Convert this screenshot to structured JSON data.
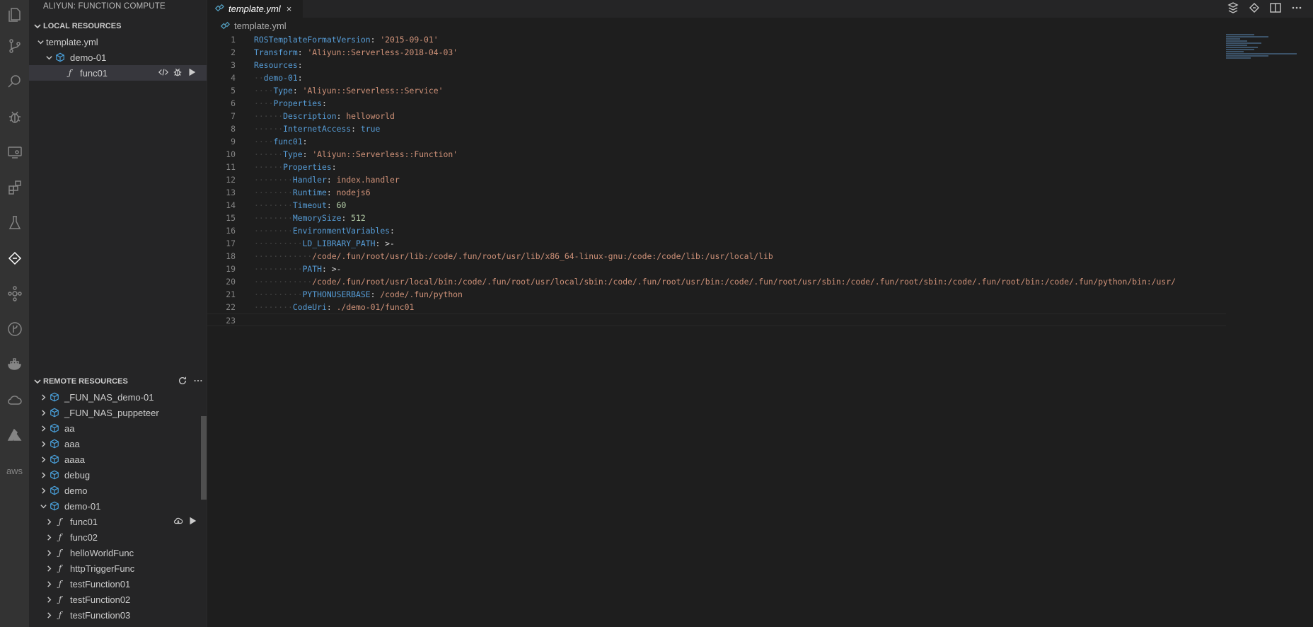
{
  "activity_bar": {
    "icons": [
      "explorer-icon",
      "source-control-icon",
      "search-icon",
      "debug-icon",
      "remote-explorer-icon",
      "extensions-icon",
      "testing-icon",
      "aliyun-function-compute-icon",
      "git-graph-icon",
      "gitlens-icon",
      "docker-icon",
      "cloud-icon",
      "azure-icon",
      "aws-icon"
    ],
    "aws_label": "aws"
  },
  "sidebar": {
    "title": "ALIYUN: FUNCTION COMPUTE",
    "local": {
      "header": "LOCAL RESOURCES",
      "template": "template.yml",
      "service": "demo-01",
      "function": "func01"
    },
    "remote": {
      "header": "REMOTE RESOURCES",
      "services": [
        "_FUN_NAS_demo-01",
        "_FUN_NAS_puppeteer",
        "aa",
        "aaa",
        "aaaa",
        "debug",
        "demo"
      ],
      "expanded_service": "demo-01",
      "functions": [
        "func01",
        "func02",
        "helloWorldFunc",
        "httpTriggerFunc",
        "testFunction01",
        "testFunction02",
        "testFunction03"
      ]
    }
  },
  "editor": {
    "tab_label": "template.yml",
    "tab_close": "×",
    "breadcrumb": "template.yml",
    "lines": [
      {
        "n": "1",
        "indent": "",
        "parts": [
          [
            "k",
            "ROSTemplateFormatVersion"
          ],
          [
            "p",
            ": "
          ],
          [
            "s",
            "'2015-09-01'"
          ]
        ]
      },
      {
        "n": "2",
        "indent": "",
        "parts": [
          [
            "k",
            "Transform"
          ],
          [
            "p",
            ": "
          ],
          [
            "s",
            "'Aliyun::Serverless-2018-04-03'"
          ]
        ]
      },
      {
        "n": "3",
        "indent": "",
        "parts": [
          [
            "k",
            "Resources"
          ],
          [
            "p",
            ":"
          ]
        ]
      },
      {
        "n": "4",
        "indent": "··",
        "parts": [
          [
            "k",
            "demo-01"
          ],
          [
            "p",
            ":"
          ]
        ]
      },
      {
        "n": "5",
        "indent": "····",
        "parts": [
          [
            "k",
            "Type"
          ],
          [
            "p",
            ": "
          ],
          [
            "s",
            "'Aliyun::Serverless::Service'"
          ]
        ]
      },
      {
        "n": "6",
        "indent": "····",
        "parts": [
          [
            "k",
            "Properties"
          ],
          [
            "p",
            ":"
          ]
        ]
      },
      {
        "n": "7",
        "indent": "······",
        "parts": [
          [
            "k",
            "Description"
          ],
          [
            "p",
            ": "
          ],
          [
            "s",
            "helloworld"
          ]
        ]
      },
      {
        "n": "8",
        "indent": "······",
        "parts": [
          [
            "k",
            "InternetAccess"
          ],
          [
            "p",
            ": "
          ],
          [
            "k",
            "true"
          ]
        ]
      },
      {
        "n": "9",
        "indent": "····",
        "parts": [
          [
            "k",
            "func01"
          ],
          [
            "p",
            ":"
          ]
        ]
      },
      {
        "n": "10",
        "indent": "······",
        "parts": [
          [
            "k",
            "Type"
          ],
          [
            "p",
            ": "
          ],
          [
            "s",
            "'Aliyun::Serverless::Function'"
          ]
        ]
      },
      {
        "n": "11",
        "indent": "······",
        "parts": [
          [
            "k",
            "Properties"
          ],
          [
            "p",
            ":"
          ]
        ]
      },
      {
        "n": "12",
        "indent": "········",
        "parts": [
          [
            "k",
            "Handler"
          ],
          [
            "p",
            ": "
          ],
          [
            "s",
            "index.handler"
          ]
        ]
      },
      {
        "n": "13",
        "indent": "········",
        "parts": [
          [
            "k",
            "Runtime"
          ],
          [
            "p",
            ": "
          ],
          [
            "s",
            "nodejs6"
          ]
        ]
      },
      {
        "n": "14",
        "indent": "········",
        "parts": [
          [
            "k",
            "Timeout"
          ],
          [
            "p",
            ": "
          ],
          [
            "n",
            "60"
          ]
        ]
      },
      {
        "n": "15",
        "indent": "········",
        "parts": [
          [
            "k",
            "MemorySize"
          ],
          [
            "p",
            ": "
          ],
          [
            "n",
            "512"
          ]
        ]
      },
      {
        "n": "16",
        "indent": "········",
        "parts": [
          [
            "k",
            "EnvironmentVariables"
          ],
          [
            "p",
            ":"
          ]
        ]
      },
      {
        "n": "17",
        "indent": "··········",
        "parts": [
          [
            "k",
            "LD_LIBRARY_PATH"
          ],
          [
            "p",
            ": "
          ],
          [
            "p",
            ">-"
          ]
        ]
      },
      {
        "n": "18",
        "indent": "············",
        "parts": [
          [
            "s",
            "/code/.fun/root/usr/lib:/code/.fun/root/usr/lib/x86_64-linux-gnu:/code:/code/lib:/usr/local/lib"
          ]
        ]
      },
      {
        "n": "19",
        "indent": "··········",
        "parts": [
          [
            "k",
            "PATH"
          ],
          [
            "p",
            ": "
          ],
          [
            "p",
            ">-"
          ]
        ]
      },
      {
        "n": "20",
        "indent": "············",
        "parts": [
          [
            "s",
            "/code/.fun/root/usr/local/bin:/code/.fun/root/usr/local/sbin:/code/.fun/root/usr/bin:/code/.fun/root/usr/sbin:/code/.fun/root/sbin:/code/.fun/root/bin:/code/.fun/python/bin:/usr/"
          ]
        ]
      },
      {
        "n": "21",
        "indent": "··········",
        "parts": [
          [
            "k",
            "PYTHONUSERBASE"
          ],
          [
            "p",
            ": "
          ],
          [
            "s",
            "/code/.fun/python"
          ]
        ]
      },
      {
        "n": "22",
        "indent": "········",
        "parts": [
          [
            "k",
            "CodeUri"
          ],
          [
            "p",
            ": "
          ],
          [
            "s",
            "./demo-01/func01"
          ]
        ]
      },
      {
        "n": "23",
        "indent": "",
        "parts": []
      }
    ]
  }
}
